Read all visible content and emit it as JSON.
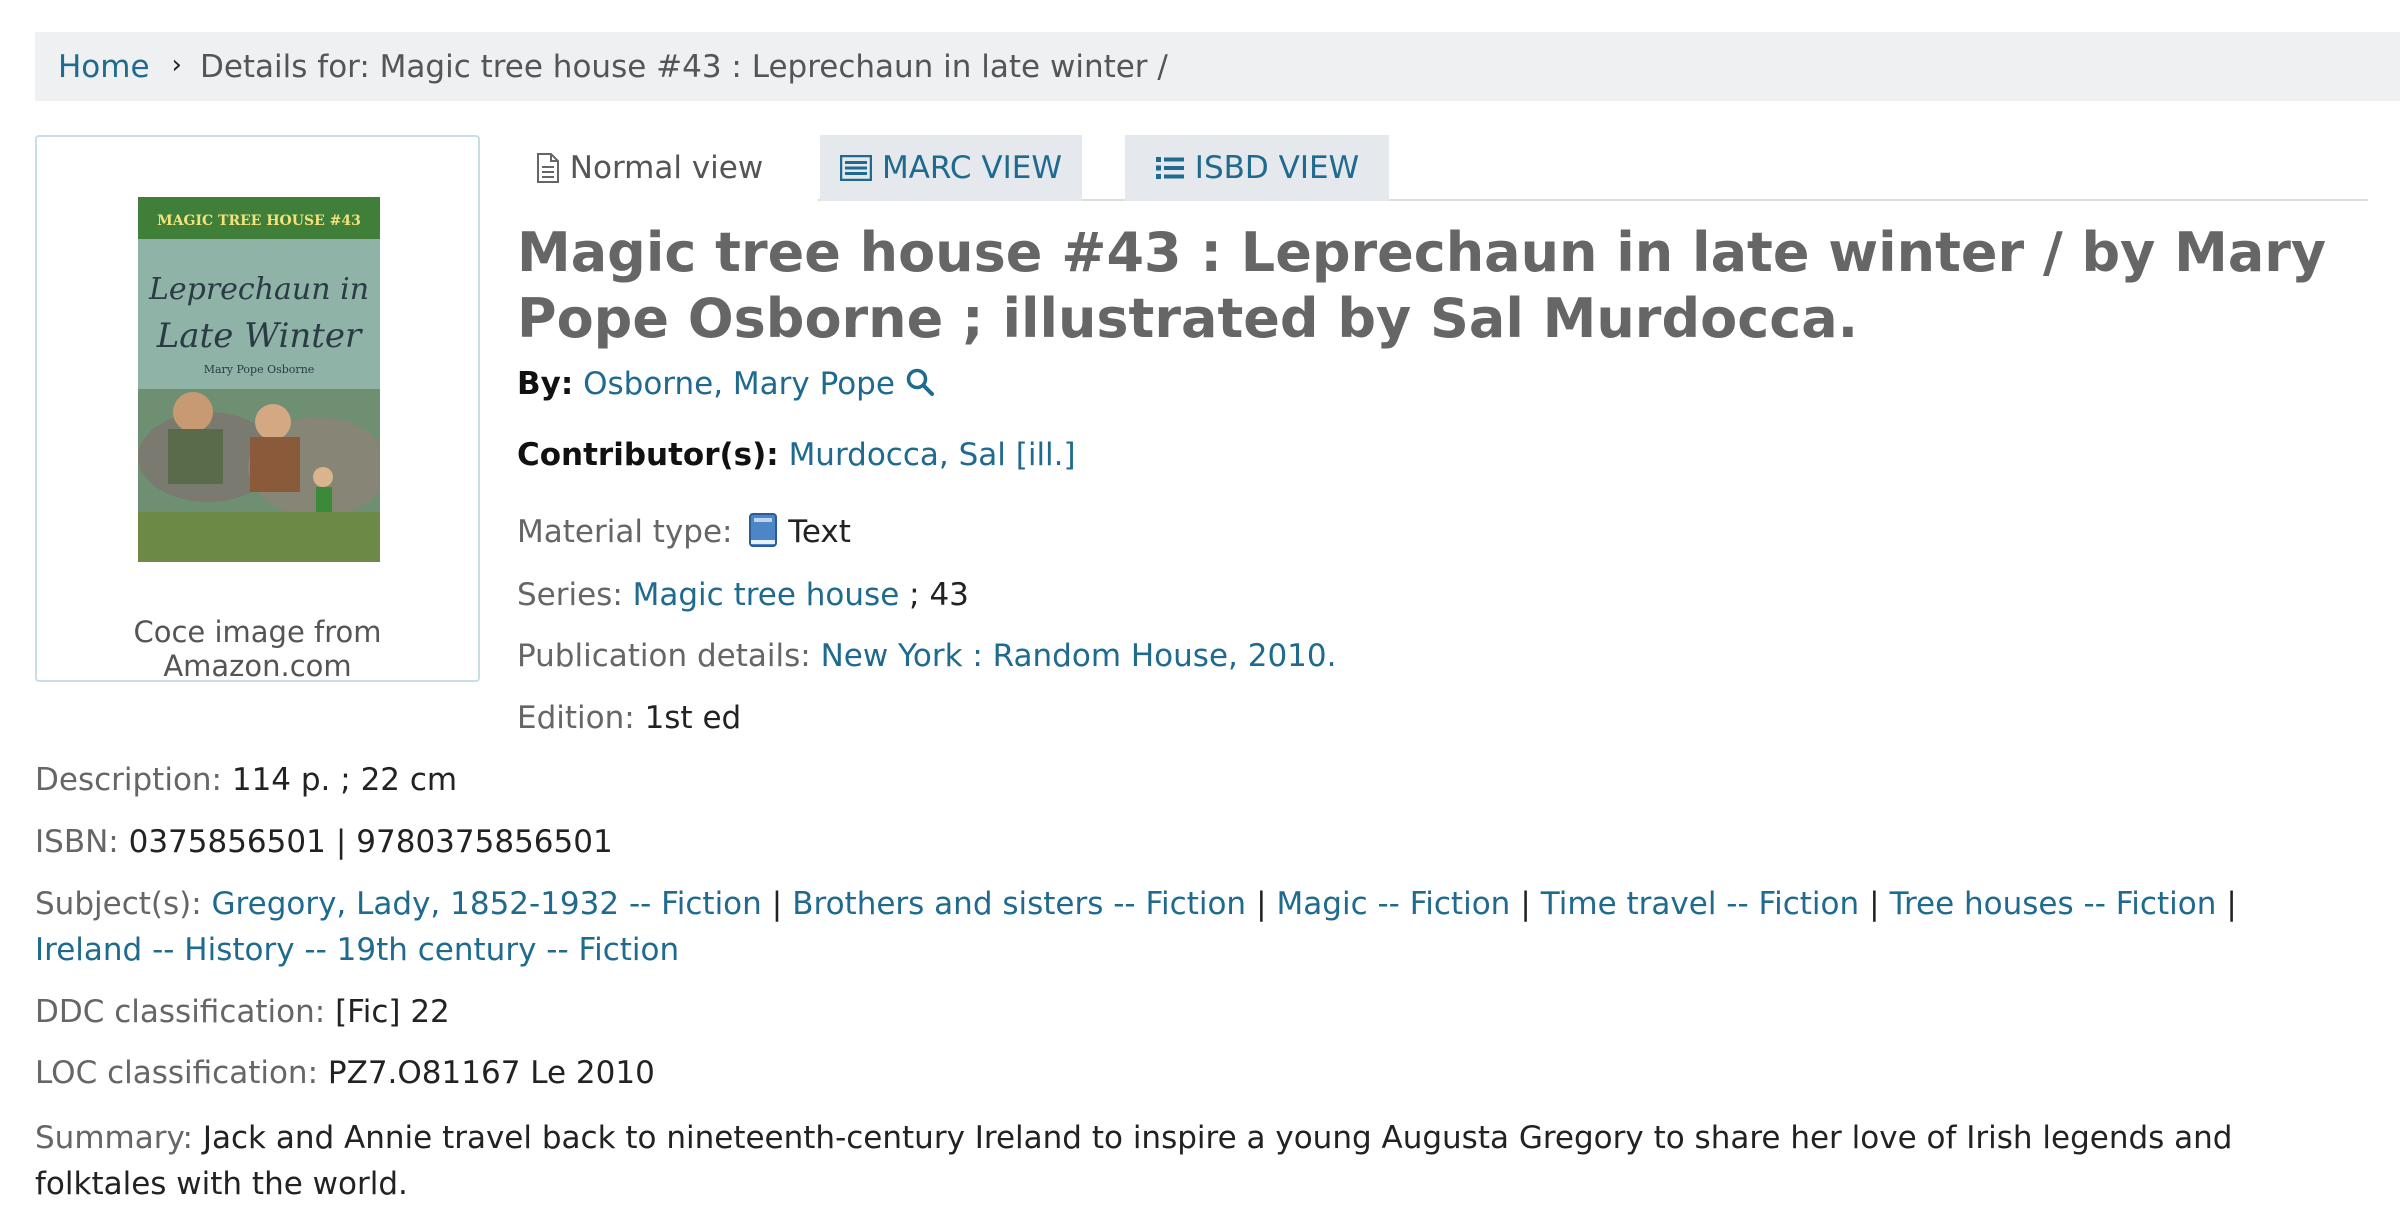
{
  "breadcrumb": {
    "home": "Home",
    "separator": "›",
    "current": "Details for: Magic tree house #43 : Leprechaun in late winter /"
  },
  "cover": {
    "caption": "Coce image from Amazon.com",
    "series_banner": "MAGIC TREE HOUSE #43",
    "book_title_line1": "Leprechaun in",
    "book_title_line2": "Late Winter",
    "book_author": "Mary Pope Osborne"
  },
  "tabs": {
    "normal": "Normal view",
    "marc": "MARC VIEW",
    "isbd": "ISBD VIEW"
  },
  "record": {
    "title": "Magic tree house #43 : Leprechaun in late winter / by Mary Pope Osborne ; illustrated by Sal Murdocca.",
    "by_label": "By:",
    "by_value": "Osborne, Mary Pope",
    "contributors_label": "Contributor(s):",
    "contributors_value": "Murdocca, Sal [ill.]",
    "material_label": "Material type:",
    "material_value": "Text",
    "series_label": "Series:",
    "series_value": "Magic tree house",
    "series_number": "; 43",
    "publication_label": "Publication details:",
    "publication_value": "New York : Random House, 2010.",
    "edition_label": "Edition:",
    "edition_value": "1st ed",
    "description_label": "Description:",
    "description_value": "114 p. ; 22 cm",
    "isbn_label": "ISBN:",
    "isbn_1": "0375856501",
    "isbn_2": "9780375856501",
    "subjects_label": "Subject(s):",
    "subjects": [
      "Gregory, Lady, 1852-1932 -- Fiction",
      "Brothers and sisters -- Fiction",
      "Magic -- Fiction",
      "Time travel -- Fiction",
      "Tree houses -- Fiction",
      "Ireland -- History -- 19th century -- Fiction"
    ],
    "ddc_label": "DDC classification:",
    "ddc_value": "[Fic] 22",
    "loc_label": "LOC classification:",
    "loc_value": "PZ7.O81167 Le 2010",
    "summary_label": "Summary:",
    "summary_value": "Jack and Annie travel back to nineteenth-century Ireland to inspire a young Augusta Gregory to share her love of Irish legends and folktales with the world."
  },
  "colors": {
    "link": "#1f6a8f",
    "breadcrumb_bg": "#eef0f2",
    "tab_inactive_bg": "#e5e8ec",
    "title": "#666666"
  },
  "icons": {
    "normal_tab": "document-icon",
    "marc_tab": "marc-card-icon",
    "isbd_tab": "list-icon",
    "author_search": "search-icon",
    "material": "book-icon"
  }
}
